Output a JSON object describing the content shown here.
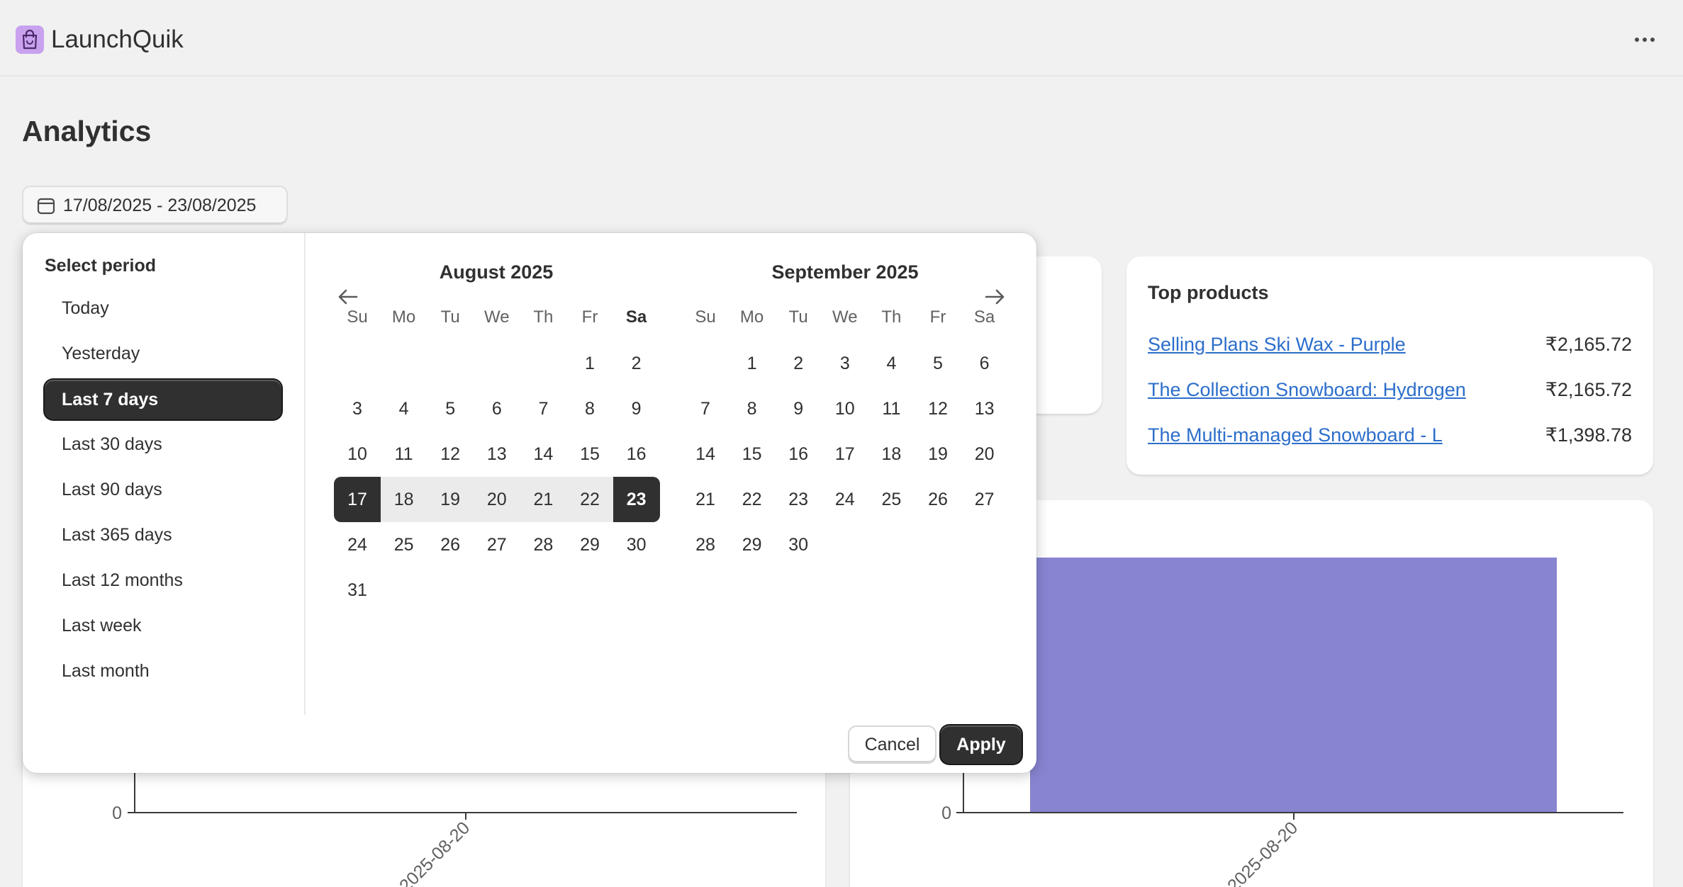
{
  "app": {
    "name": "LaunchQuik",
    "icon": "shopping-bag-icon"
  },
  "header": {
    "more_icon": "more-horizontal-icon"
  },
  "page": {
    "title": "Analytics"
  },
  "date_range": {
    "label": "17/08/2025 - 23/08/2025",
    "icon": "calendar-icon"
  },
  "picker": {
    "period_title": "Select period",
    "periods": [
      "Today",
      "Yesterday",
      "Last 7 days",
      "Last 30 days",
      "Last 90 days",
      "Last 365 days",
      "Last 12 months",
      "Last week",
      "Last month"
    ],
    "selected_period": "Last 7 days",
    "weekdays": [
      "Su",
      "Mo",
      "Tu",
      "We",
      "Th",
      "Fr",
      "Sa"
    ],
    "months": [
      {
        "title": "August 2025",
        "first_weekday": 5,
        "days": 31
      },
      {
        "title": "September 2025",
        "first_weekday": 1,
        "days": 30
      }
    ],
    "range_start": 17,
    "range_end": 23,
    "cancel_label": "Cancel",
    "apply_label": "Apply"
  },
  "top_products": {
    "title": "Top products",
    "items": [
      {
        "name": "Selling Plans Ski Wax - Purple",
        "value": "₹2,165.72"
      },
      {
        "name": "The Collection Snowboard: Hydrogen",
        "value": "₹2,165.72"
      },
      {
        "name": "The Multi-managed Snowboard - L",
        "value": "₹1,398.78"
      }
    ]
  },
  "charts": {
    "left": {
      "zero_label": "0",
      "x_label": "2025-08-20"
    },
    "right": {
      "zero_label": "0",
      "x_label": "2025-08-20",
      "bar_color": "#8884d1"
    }
  }
}
